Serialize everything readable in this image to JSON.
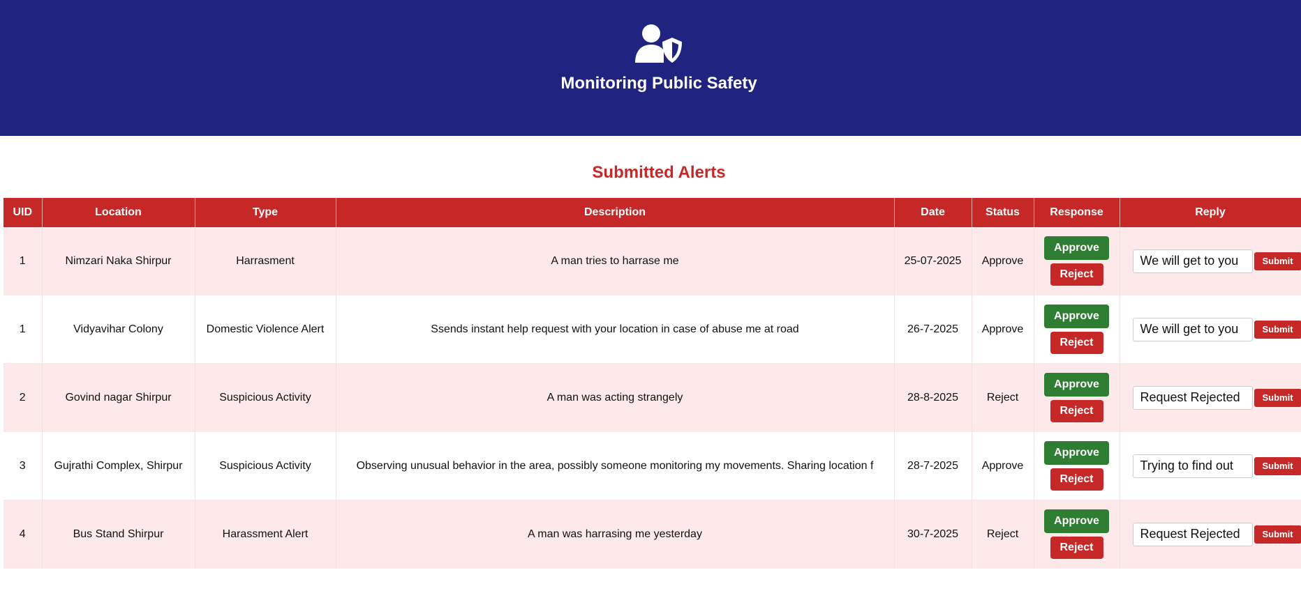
{
  "header": {
    "logo_icon": "user-shield-icon",
    "title": "Monitoring Public Safety"
  },
  "section_title": "Submitted Alerts",
  "colors": {
    "header_bg": "#20237f",
    "accent_red": "#c62828",
    "approve_green": "#2e7d32",
    "row_alt_bg": "#fde9e9"
  },
  "table": {
    "columns": [
      "UID",
      "Location",
      "Type",
      "Description",
      "Date",
      "Status",
      "Response",
      "Reply"
    ],
    "approve_label": "Approve",
    "reject_label": "Reject",
    "submit_label": "Submit",
    "rows": [
      {
        "uid": "1",
        "location": "Nimzari Naka Shirpur",
        "type": "Harrasment",
        "description": "A man tries to harrase me",
        "date": "25-07-2025",
        "status": "Approve",
        "reply": "We will get to you"
      },
      {
        "uid": "1",
        "location": "Vidyavihar Colony",
        "type": "Domestic Violence Alert",
        "description": "Ssends instant help request with your location in case of abuse me at road",
        "date": "26-7-2025",
        "status": "Approve",
        "reply": "We will get to you"
      },
      {
        "uid": "2",
        "location": "Govind nagar Shirpur",
        "type": "Suspicious Activity",
        "description": "A man was acting strangely",
        "date": "28-8-2025",
        "status": "Reject",
        "reply": "Request Rejected"
      },
      {
        "uid": "3",
        "location": "Gujrathi Complex, Shirpur",
        "type": "Suspicious Activity",
        "description": "Observing unusual behavior in the area, possibly someone monitoring my movements. Sharing location f",
        "date": "28-7-2025",
        "status": "Approve",
        "reply": "Trying to find out"
      },
      {
        "uid": "4",
        "location": "Bus Stand Shirpur",
        "type": "Harassment Alert",
        "description": "A man was harrasing me yesterday",
        "date": "30-7-2025",
        "status": "Reject",
        "reply": "Request Rejected"
      }
    ]
  }
}
